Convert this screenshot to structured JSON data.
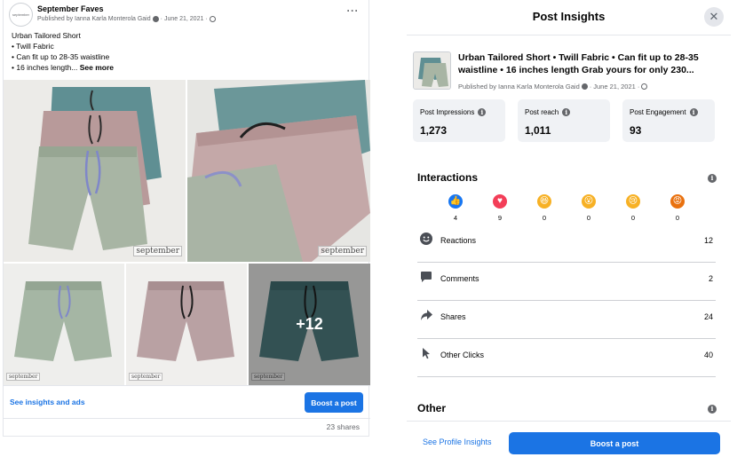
{
  "post": {
    "page_name": "September Faves",
    "avatar_text": "september",
    "published_by": "Published by Ianna Karla Monterola Gaid",
    "separator": "·",
    "date": "June 21, 2021",
    "more_label": "···",
    "text_lines": [
      "Urban Tailored Short",
      "• Twill Fabric",
      "• Can fit up to 28-35 waistline",
      "• 16 inches length..."
    ],
    "see_more": "See more",
    "watermark": "september",
    "more_photos": "+12",
    "see_insights_link": "See insights and ads",
    "boost_label": "Boost a post",
    "shares": "23 shares"
  },
  "panel": {
    "title": "Post Insights",
    "close_label": "✕",
    "post_title": "Urban Tailored Short • Twill Fabric • Can fit up to 28-35 waistline • 16 inches length Grab yours for only 230...",
    "published_by": "Published by Ianna Karla Monterola Gaid",
    "separator": "·",
    "date": "June 21, 2021",
    "info_glyph": "i",
    "stats": [
      {
        "label": "Post Impressions",
        "value": "1,273"
      },
      {
        "label": "Post reach",
        "value": "1,011"
      },
      {
        "label": "Post Engagement",
        "value": "93"
      }
    ],
    "interactions_title": "Interactions",
    "reactions": [
      {
        "name": "like",
        "glyph": "👍",
        "color": "#1877f2",
        "count": "4"
      },
      {
        "name": "love",
        "glyph": "♥",
        "color": "#f33e58",
        "count": "9"
      },
      {
        "name": "haha",
        "glyph": "😆",
        "color": "#f7b125",
        "count": "0"
      },
      {
        "name": "wow",
        "glyph": "😮",
        "color": "#f7b125",
        "count": "0"
      },
      {
        "name": "sad",
        "glyph": "😢",
        "color": "#f7b125",
        "count": "0"
      },
      {
        "name": "angry",
        "glyph": "😡",
        "color": "#e9710f",
        "count": "0"
      }
    ],
    "metrics": [
      {
        "icon": "smiley-icon",
        "label": "Reactions",
        "value": "12"
      },
      {
        "icon": "comment-icon",
        "label": "Comments",
        "value": "2"
      },
      {
        "icon": "share-icon",
        "label": "Shares",
        "value": "24"
      },
      {
        "icon": "cursor-icon",
        "label": "Other Clicks",
        "value": "40"
      }
    ],
    "other_title": "Other",
    "profile_link": "See Profile Insights",
    "boost_label": "Boost a post"
  },
  "colors": {
    "accent": "#1b74e4",
    "card_bg": "#f0f2f5",
    "muted_text": "#65676b",
    "short_teal": "#5f8f93",
    "short_pink": "#b89a9a",
    "short_sage": "#a8b5a4"
  }
}
